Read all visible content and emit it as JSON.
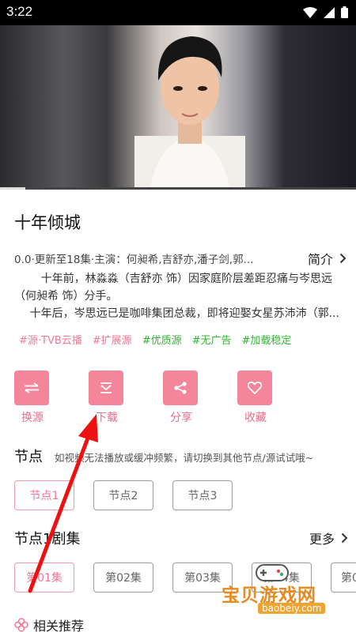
{
  "status_bar": {
    "time": "3:22"
  },
  "video": {
    "progress": 0.07
  },
  "show": {
    "title": "十年倾城",
    "meta": "0.0·更新至18集·主演：何昶希,吉舒亦,潘子剑,郭...",
    "intro_label": "简介",
    "description": [
      "十年前，林淼淼（吉舒亦 饰）因家庭阶层差距忍痛与岑思远（何昶希 饰）分手。",
      "十年后，岑思远已是咖啡集团总裁，即将迎娶女星苏沛沛（郭..."
    ],
    "tags": [
      {
        "text": "#源·TVB云播",
        "color": "#f07a95"
      },
      {
        "text": "#扩展源",
        "color": "#f07a95"
      },
      {
        "text": "#优质源",
        "color": "#2eb82e"
      },
      {
        "text": "#无广告",
        "color": "#2eb82e"
      },
      {
        "text": "#加载稳定",
        "color": "#2eb82e"
      }
    ]
  },
  "actions": [
    {
      "label": "换源",
      "icon": "swap-icon"
    },
    {
      "label": "下载",
      "icon": "download-icon"
    },
    {
      "label": "分享",
      "icon": "share-icon"
    },
    {
      "label": "收藏",
      "icon": "heart-icon"
    }
  ],
  "nodes": {
    "label": "节点",
    "hint": "如视频无法播放或缓冲频繁，请切换到其他节点/源试试哦~",
    "items": [
      "节点1",
      "节点2",
      "节点3"
    ],
    "selected": 0
  },
  "episodes": {
    "label": "节点1剧集",
    "more_label": "更多",
    "items": [
      "第01集",
      "第02集",
      "第03集",
      "第04集",
      "第05集"
    ],
    "selected": 0
  },
  "related": {
    "label": "相关推荐"
  },
  "watermark": {
    "text": "宝贝游戏网",
    "url": "baobeiy.com"
  },
  "colors": {
    "accent": "#f4869c",
    "accent_text": "#e86f8a",
    "green_tag": "#2eb82e"
  }
}
